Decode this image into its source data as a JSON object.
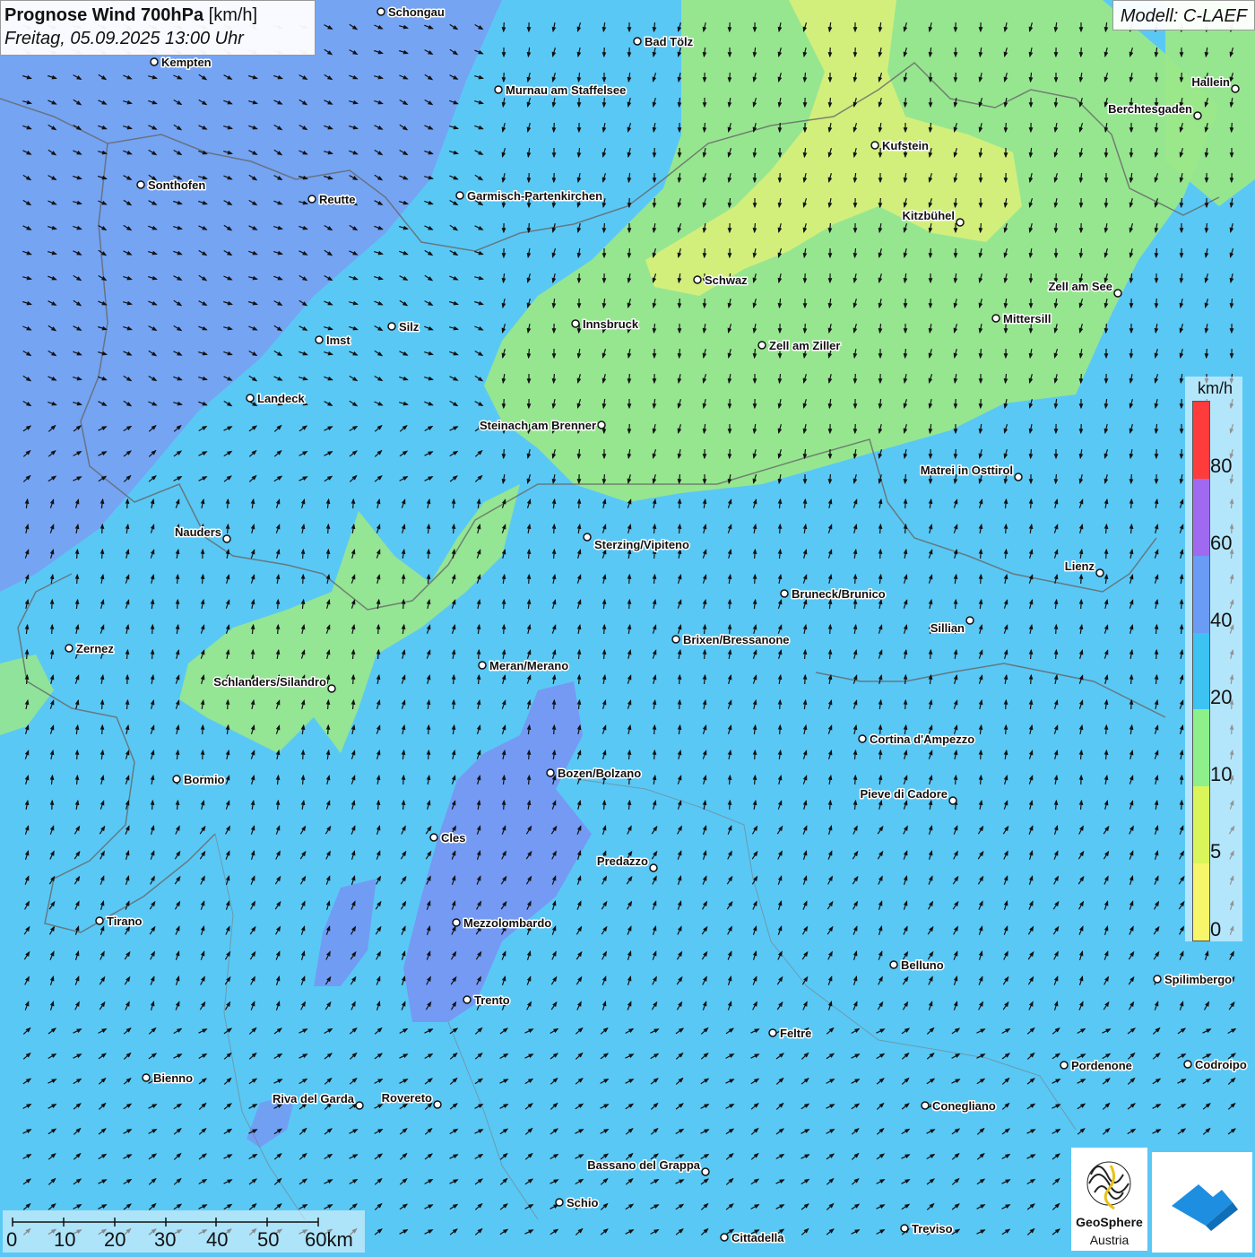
{
  "title": {
    "main": "Prognose Wind 700hPa",
    "unit": "[km/h]",
    "datetime": "Freitag, 05.09.2025 13:00 Uhr"
  },
  "model": "Modell: C-LAEF",
  "legend": {
    "unit": "km/h",
    "ticks": [
      "80",
      "60",
      "40",
      "20",
      "10",
      "5",
      "0"
    ],
    "colors": [
      "#ff3b3b",
      "#a06af0",
      "#6a9bf5",
      "#3cc3f2",
      "#8ef08a",
      "#d9f55a",
      "#f7f56a"
    ]
  },
  "scalebar": {
    "labels": [
      "0",
      "10",
      "20",
      "30",
      "40",
      "50",
      "60km"
    ]
  },
  "logos": {
    "geosphere_name": "GeoSphere",
    "geosphere_sub": "Austria"
  },
  "colors": {
    "base_wind_20_40": "#5ac8f5",
    "wind_10_20": "#9ae88a",
    "wind_5_10": "#d8f07a",
    "wind_40_60": "#6e8ff0"
  },
  "cities": [
    {
      "name": "Schongau"
    },
    {
      "name": "Bad Tölz"
    },
    {
      "name": "Kempten"
    },
    {
      "name": "Murnau am Staffelsee"
    },
    {
      "name": "Hallein"
    },
    {
      "name": "Berchtesgaden"
    },
    {
      "name": "Kufstein"
    },
    {
      "name": "Sonthofen"
    },
    {
      "name": "Reutte"
    },
    {
      "name": "Garmisch-Partenkirchen"
    },
    {
      "name": "Kitzbühel"
    },
    {
      "name": "Schwaz"
    },
    {
      "name": "Zell am See"
    },
    {
      "name": "Innsbruck"
    },
    {
      "name": "Mittersill"
    },
    {
      "name": "Silz"
    },
    {
      "name": "Imst"
    },
    {
      "name": "Zell am Ziller"
    },
    {
      "name": "Landeck"
    },
    {
      "name": "Steinach am Brenner"
    },
    {
      "name": "Matrei in Osttirol"
    },
    {
      "name": "Nauders"
    },
    {
      "name": "Sterzing/Vipiteno"
    },
    {
      "name": "Lienz"
    },
    {
      "name": "Bruneck/Brunico"
    },
    {
      "name": "Sillian"
    },
    {
      "name": "Zernez"
    },
    {
      "name": "Brixen/Bressanone"
    },
    {
      "name": "Meran/Merano"
    },
    {
      "name": "Schlanders/Silandro"
    },
    {
      "name": "Cortina d'Ampezzo"
    },
    {
      "name": "Bozen/Bolzano"
    },
    {
      "name": "Bormio"
    },
    {
      "name": "Pieve di Cadore"
    },
    {
      "name": "Cles"
    },
    {
      "name": "Predazzo"
    },
    {
      "name": "Tirano"
    },
    {
      "name": "Mezzolombardo"
    },
    {
      "name": "Belluno"
    },
    {
      "name": "Spilimbergo"
    },
    {
      "name": "Trento"
    },
    {
      "name": "Feltre"
    },
    {
      "name": "Pordenone"
    },
    {
      "name": "Codroipo"
    },
    {
      "name": "Bienno"
    },
    {
      "name": "Riva del Garda"
    },
    {
      "name": "Rovereto"
    },
    {
      "name": "Conegliano"
    },
    {
      "name": "Bassano del Grappa"
    },
    {
      "name": "Schio"
    },
    {
      "name": "Treviso"
    },
    {
      "name": "Cittadella"
    }
  ]
}
